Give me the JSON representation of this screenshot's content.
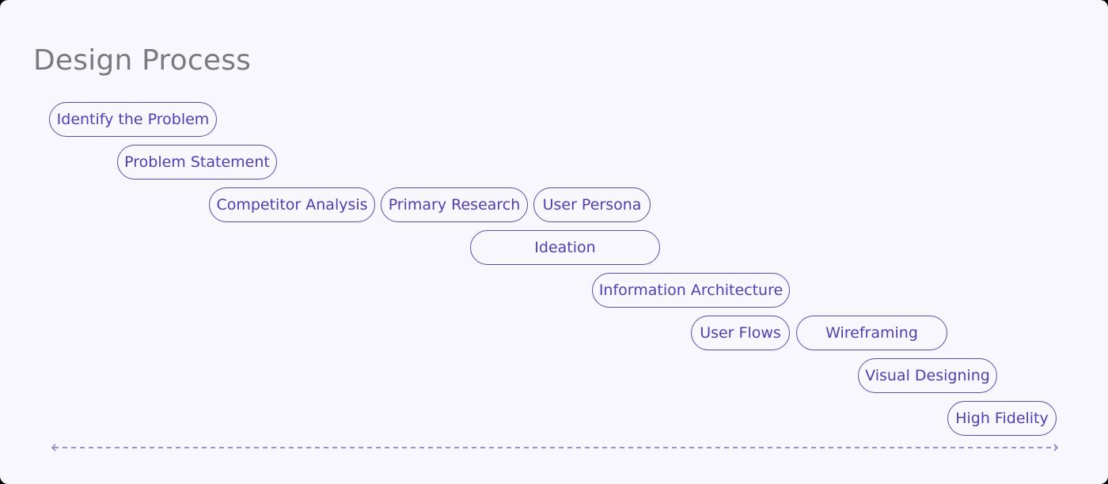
{
  "title": "Design Process",
  "steps": [
    "Identify the Problem",
    "Problem Statement",
    "Competitor Analysis",
    "Primary Research",
    "User Persona",
    "Ideation",
    "Information Architecture",
    "User Flows",
    "Wireframing",
    "Visual Designing",
    "High Fidelity"
  ],
  "colors": {
    "accent": "#5a4fa8",
    "text": "#4f3fb0",
    "background": "#f8f7fd",
    "title": "#7b7b7d"
  }
}
